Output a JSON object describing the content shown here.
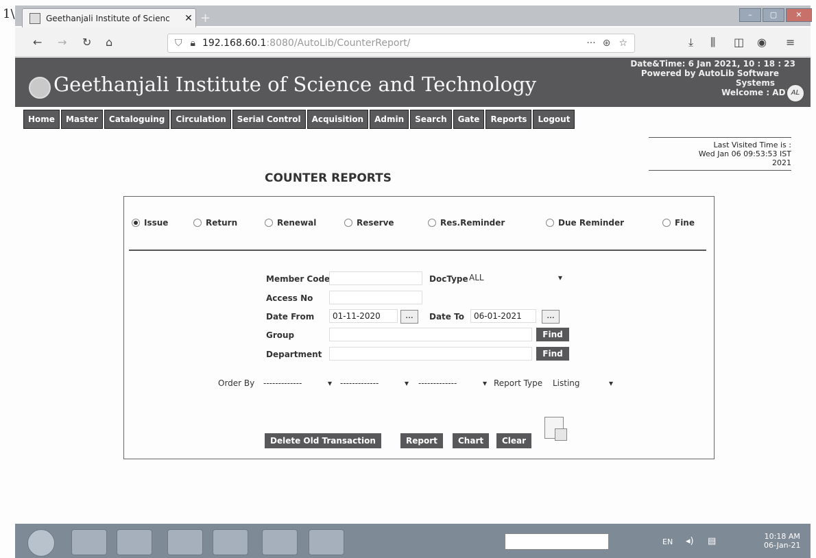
{
  "corner_mark": "1\\",
  "browser": {
    "tab_title": "Geethanjali Institute of Scienc",
    "url_host": "192.168.60.1",
    "url_rest": ":8080/AutoLib/CounterReport/",
    "url_more": "···"
  },
  "header": {
    "institute": "Geethanjali Institute of Science and Technology",
    "datetime": "Date&Time:  6 Jan 2021, 10 : 18 : 23",
    "powered_1": "Powered by AutoLib Software",
    "powered_2": "Systems",
    "welcome": "Welcome   :   ADMIN",
    "logo_mark": "AL"
  },
  "menu": [
    "Home",
    "Master",
    "Cataloguing",
    "Circulation",
    "Serial Control",
    "Acquisition",
    "Admin",
    "Search",
    "Gate",
    "Reports",
    "Logout"
  ],
  "last_visited": {
    "label": "Last Visited Time is :",
    "value_1": "Wed Jan 06 09:53:53 IST",
    "value_2": "2021"
  },
  "page_title": "COUNTER REPORTS",
  "report_options": {
    "issue": "Issue",
    "return": "Return",
    "renewal": "Renewal",
    "reserve": "Reserve",
    "res_reminder": "Res.Reminder",
    "due_reminder": "Due Reminder",
    "fine": "Fine",
    "selected": "Issue"
  },
  "form": {
    "member_code_label": "Member Code",
    "member_code_value": "",
    "doctype_label": "DocType",
    "doctype_value": "ALL",
    "access_no_label": "Access No",
    "access_no_value": "",
    "date_from_label": "Date From",
    "date_from_value": "01-11-2020",
    "date_to_label": "Date To",
    "date_to_value": "06-01-2021",
    "picker_label": "...",
    "group_label": "Group",
    "group_value": "",
    "department_label": "Department",
    "department_value": "",
    "find_label": "Find",
    "order_by_label": "Order By",
    "order_by_1": "-------------",
    "order_by_2": "-------------",
    "order_by_3": "-------------",
    "report_type_label": "Report Type",
    "report_type_value": "Listing"
  },
  "actions": {
    "delete_old": "Delete Old Transaction",
    "report": "Report",
    "chart": "Chart",
    "clear": "Clear"
  },
  "taskbar": {
    "time": "10:18 AM",
    "date": "06-Jan-21",
    "lang": "EN"
  }
}
